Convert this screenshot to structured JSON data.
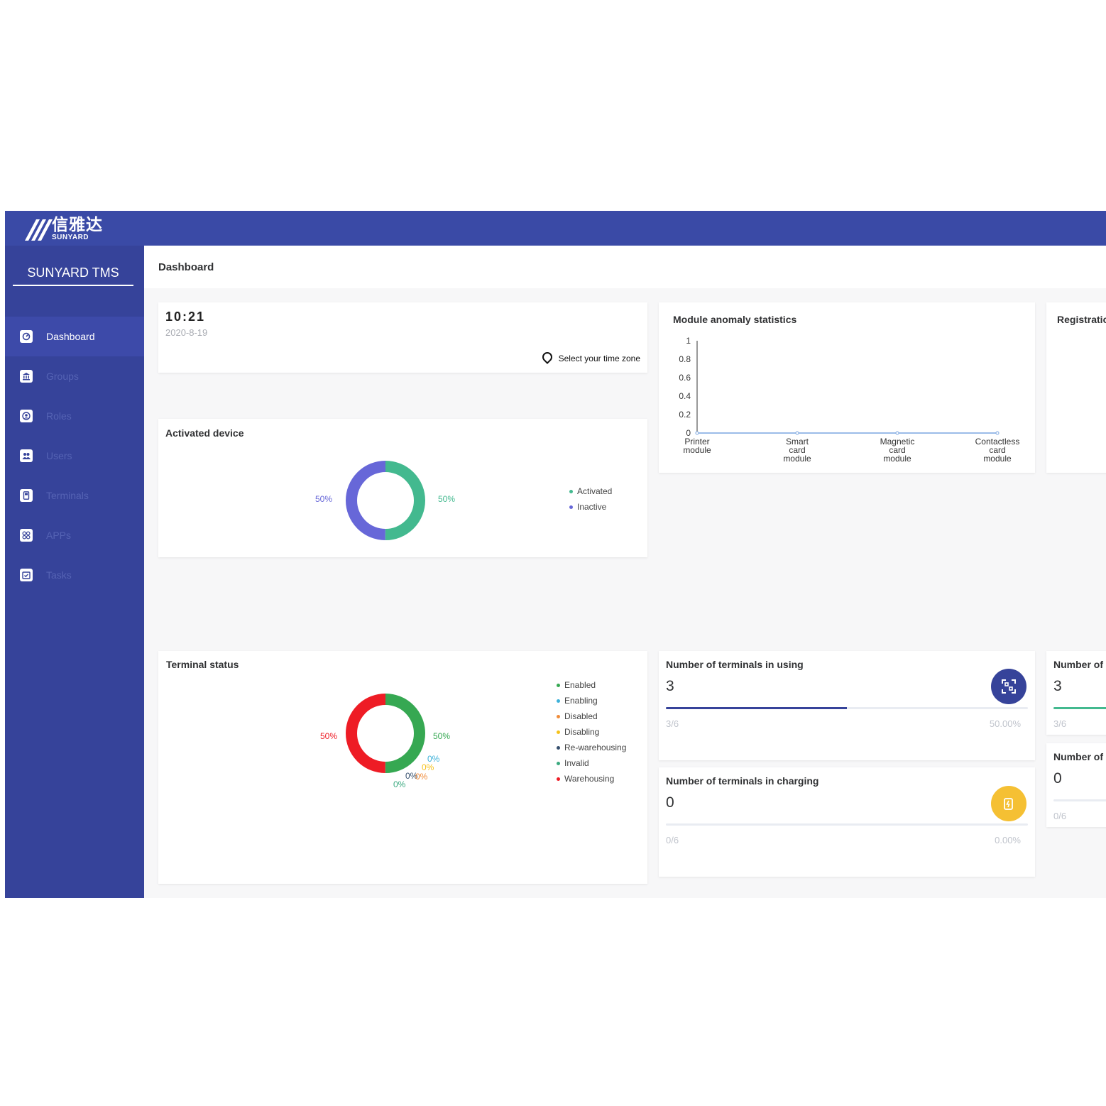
{
  "header": {
    "logo_cn": "信雅达",
    "logo_en": "SUNYARD"
  },
  "sidebar": {
    "brand": "SUNYARD TMS",
    "items": [
      {
        "label": "Dashboard",
        "icon": "dashboard-icon"
      },
      {
        "label": "Groups",
        "icon": "bank-icon"
      },
      {
        "label": "Roles",
        "icon": "role-icon"
      },
      {
        "label": "Users",
        "icon": "users-icon"
      },
      {
        "label": "Terminals",
        "icon": "terminal-icon"
      },
      {
        "label": "APPs",
        "icon": "apps-icon"
      },
      {
        "label": "Tasks",
        "icon": "tasks-icon"
      }
    ]
  },
  "page": {
    "title": "Dashboard"
  },
  "clock": {
    "time": "10:21",
    "date": "2020-8-19",
    "timezone_label": "Select your time zone"
  },
  "activated": {
    "title": "Activated device",
    "labels": {
      "activated": "50%",
      "inactive": "50%"
    },
    "legend": [
      "Activated",
      "Inactive"
    ]
  },
  "terminal_status": {
    "title": "Terminal status",
    "legend": [
      "Enabled",
      "Enabling",
      "Disabled",
      "Disabling",
      "Re-warehousing",
      "Invalid",
      "Warehousing"
    ],
    "labels": {
      "enabled": "50%",
      "warehousing": "50%",
      "enabling": "0%",
      "disabling": "0%",
      "disabled": "0%",
      "rewarehousing": "0%",
      "invalid": "0%"
    }
  },
  "module_stats": {
    "title": "Module anomaly statistics"
  },
  "registration": {
    "title": "Registratic"
  },
  "using": {
    "title": "Number of terminals in using",
    "value": "3",
    "ratio": "3/6",
    "percent": "50.00%"
  },
  "charging": {
    "title": "Number of terminals in charging",
    "value": "0",
    "ratio": "0/6",
    "percent": "0.00%"
  },
  "partial_cards": [
    {
      "title": "Number of",
      "value": "3",
      "ratio": "3/6"
    },
    {
      "title": "Number of",
      "value": "0",
      "ratio": "0/6"
    }
  ],
  "colors": {
    "header": "#3a4aa6",
    "sidebar": "#36439a",
    "activated": "#43b98f",
    "inactive": "#6767d8",
    "enabled": "#36a852",
    "enabling": "#3db1d9",
    "disabled": "#f08c3a",
    "disabling": "#f5c21b",
    "rewarehousing": "#36506e",
    "invalid": "#3aa97f",
    "warehousing": "#ee1c25",
    "using_icon": "#36439a",
    "charging_icon": "#f5c033"
  },
  "chart_data": [
    {
      "type": "pie",
      "title": "Activated device",
      "categories": [
        "Activated",
        "Inactive"
      ],
      "values": [
        50,
        50
      ]
    },
    {
      "type": "pie",
      "title": "Terminal status",
      "categories": [
        "Enabled",
        "Enabling",
        "Disabled",
        "Disabling",
        "Re-warehousing",
        "Invalid",
        "Warehousing"
      ],
      "values": [
        50,
        0,
        0,
        0,
        0,
        0,
        50
      ]
    },
    {
      "type": "line",
      "title": "Module anomaly statistics",
      "categories": [
        "Printer module",
        "Smart card module",
        "Magnetic card module",
        "Contactless card module"
      ],
      "values": [
        0,
        0,
        0,
        0
      ],
      "ylim": [
        0,
        1
      ],
      "yticks": [
        "0",
        "0.2",
        "0.4",
        "0.6",
        "0.8",
        "1"
      ],
      "xticks": [
        [
          "Printer",
          "module"
        ],
        [
          "Smart",
          "card",
          "module"
        ],
        [
          "Magnetic",
          "card",
          "module"
        ],
        [
          "Contactless",
          "card",
          "module"
        ]
      ]
    }
  ]
}
